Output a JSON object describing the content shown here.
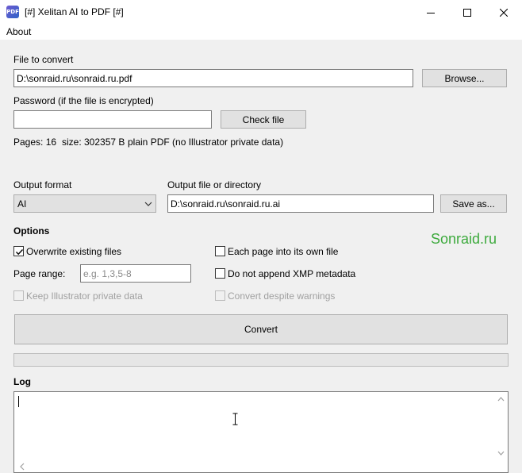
{
  "window": {
    "title": "[#] Xelitan AI to PDF [#]",
    "icon": "app-pdf-icon",
    "controls": [
      "minimize-icon",
      "maximize-icon",
      "close-icon"
    ]
  },
  "menu": {
    "about": "About"
  },
  "file": {
    "label": "File to convert",
    "value": "D:\\sonraid.ru\\sonraid.ru.pdf",
    "browse": "Browse..."
  },
  "password": {
    "label": "Password (if the file is encrypted)",
    "value": "",
    "check": "Check file"
  },
  "info": {
    "pages": "Pages: 16",
    "size": "size: 302357 B",
    "kind": "plain PDF (no Illustrator private data)"
  },
  "output": {
    "format_label": "Output format",
    "format_value": "AI",
    "path_label": "Output file or directory",
    "path_value": "D:\\sonraid.ru\\sonraid.ru.ai",
    "save_as": "Save as..."
  },
  "options": {
    "heading": "Options",
    "overwrite": {
      "label": "Overwrite existing files",
      "checked": true
    },
    "each_page": {
      "label": "Each page into its own file",
      "checked": false
    },
    "page_range_label": "Page range:",
    "page_range_value": "",
    "page_range_placeholder": "e.g. 1,3,5-8",
    "no_xmp": {
      "label": "Do not append XMP metadata",
      "checked": false
    },
    "keep_private": {
      "label": "Keep Illustrator private data",
      "checked": false,
      "enabled": false
    },
    "convert_warnings": {
      "label": "Convert despite warnings",
      "checked": false,
      "enabled": false
    }
  },
  "watermark": "Sonraid.ru",
  "convert": "Convert",
  "progress": 0,
  "log": {
    "label": "Log",
    "text": ""
  },
  "colors": {
    "accent": "#3daa3d",
    "check": "#000000"
  }
}
